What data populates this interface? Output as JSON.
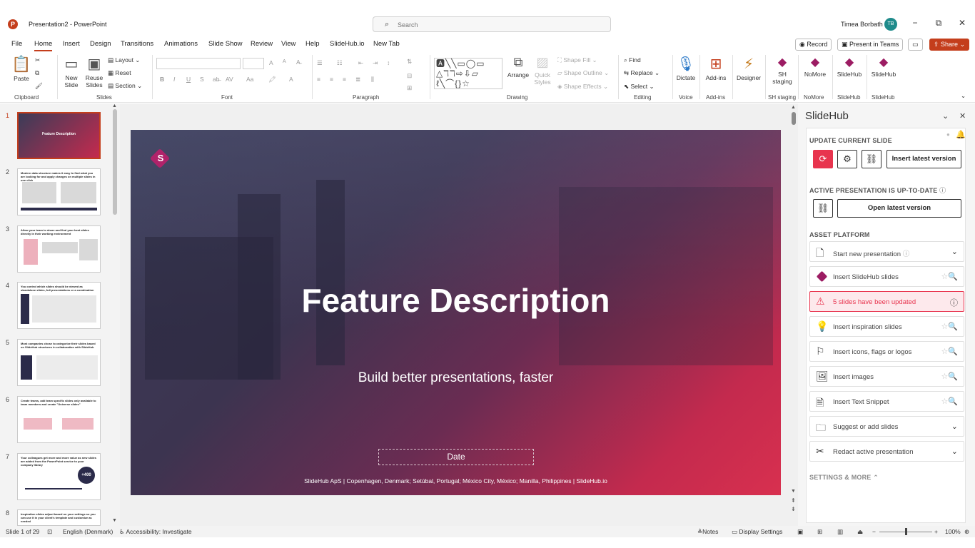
{
  "window": {
    "doc_title": "Presentation2 - PowerPoint",
    "search_placeholder": "Search",
    "user_name": "Timea Borbath",
    "user_initials": "TB",
    "minimize": "−",
    "restore": "⧉",
    "close": "✕"
  },
  "tabs": [
    "File",
    "Home",
    "Insert",
    "Design",
    "Transitions",
    "Animations",
    "Slide Show",
    "Review",
    "View",
    "Help",
    "SlideHub.io",
    "New Tab"
  ],
  "top_buttons": {
    "record": "Record",
    "present_teams": "Present in Teams",
    "share": "Share"
  },
  "ribbon": {
    "clipboard": {
      "paste": "Paste",
      "label": "Clipboard"
    },
    "slides": {
      "new_slide": "New Slide",
      "reuse_slides": "Reuse Slides",
      "layout": "Layout",
      "reset": "Reset",
      "section": "Section",
      "label": "Slides"
    },
    "font": {
      "label": "Font",
      "bold": "B",
      "italic": "I",
      "underline": "U",
      "strike": "S",
      "grow": "A",
      "shrink": "A"
    },
    "paragraph": {
      "label": "Paragraph"
    },
    "drawing": {
      "arrange": "Arrange",
      "quick_styles": "Quick Styles",
      "shape_fill": "Shape Fill",
      "shape_outline": "Shape Outline",
      "shape_effects": "Shape Effects",
      "label": "Drawing"
    },
    "editing": {
      "find": "Find",
      "replace": "Replace",
      "select": "Select",
      "label": "Editing"
    },
    "voice": {
      "dictate": "Dictate",
      "label": "Voice"
    },
    "addins": {
      "addins": "Add-ins",
      "label": "Add-ins"
    },
    "designer": {
      "designer": "Designer"
    },
    "sh_staging": {
      "btn": "SH staging",
      "label": "SH staging"
    },
    "nomore": {
      "btn": "NoMore",
      "label": "NoMore"
    },
    "slidehub1": {
      "btn": "SlideHub",
      "label": "SlideHub"
    },
    "slidehub2": {
      "btn": "SlideHub",
      "label": "SlideHub"
    }
  },
  "thumbnails": [
    {
      "num": "1",
      "title": "Feature Description"
    },
    {
      "num": "2",
      "title": "Modern data structure makes it easy to find what you are looking for and apply changes on multiple slides in one click"
    },
    {
      "num": "3",
      "title": "Allow your team to share and find your best slides directly in their working environment"
    },
    {
      "num": "4",
      "title": "You control which slides should be viewed as standalone slides, full presentations or a combination"
    },
    {
      "num": "5",
      "title": "Most companies chose to categorize their slides based on SlideHub structures in collaboration with SlideHub"
    },
    {
      "num": "6",
      "title": "Create teams, add team specific slides only available to team members and create \"Universe slides\""
    },
    {
      "num": "7",
      "title": "Your colleagues get more and more value as new slides are added from the PowerPoint service to your company library",
      "badge": "+400"
    },
    {
      "num": "8",
      "title": "Inspiration slides adjust based on your settings so you can use it in your client's template and customize as needed"
    }
  ],
  "slide": {
    "logo_letter": "S",
    "title": "Feature Description",
    "subtitle": "Build better presentations, faster",
    "date": "Date",
    "footer": "SlideHub ApS   |   Copenhagen, Denmark; Setúbal, Portugal; México City, México; Manilla, Philippines |   SlideHub.io"
  },
  "panel": {
    "title": "SlideHub",
    "update_header": "UPDATE CURRENT SLIDE",
    "insert_latest": "Insert latest version",
    "active_header": "ACTIVE PRESENTATION IS UP-TO-DATE",
    "open_latest": "Open latest version",
    "asset_header": "ASSET PLATFORM",
    "items": [
      {
        "label": "Start new presentation",
        "icon": "🗋",
        "right": "⌄"
      },
      {
        "label": "Insert SlideHub slides",
        "icon": "",
        "right": "☆🔍"
      },
      {
        "label": "5 slides have been updated",
        "icon": "⚠",
        "right": "ⓘ"
      },
      {
        "label": "Insert inspiration slides",
        "icon": "💡",
        "right": "☆🔍"
      },
      {
        "label": "Insert icons, flags or logos",
        "icon": "⚐",
        "right": "☆🔍"
      },
      {
        "label": "Insert images",
        "icon": "🖼",
        "right": "☆🔍"
      },
      {
        "label": "Insert Text Snippet",
        "icon": "🗎",
        "right": "☆🔍"
      },
      {
        "label": "Suggest or add slides",
        "icon": "🗀",
        "right": "⌄"
      },
      {
        "label": "Redact active presentation",
        "icon": "✂",
        "right": "⌄"
      }
    ],
    "settings": "SETTINGS & MORE"
  },
  "status": {
    "slide_count": "Slide 1 of 29",
    "language": "English (Denmark)",
    "accessibility": "Accessibility: Investigate",
    "notes": "Notes",
    "display_settings": "Display Settings",
    "zoom": "100%"
  },
  "colors": {
    "accent": "#c43e1c",
    "brand": "#e8344e",
    "slidehub": "#9c1c63"
  }
}
